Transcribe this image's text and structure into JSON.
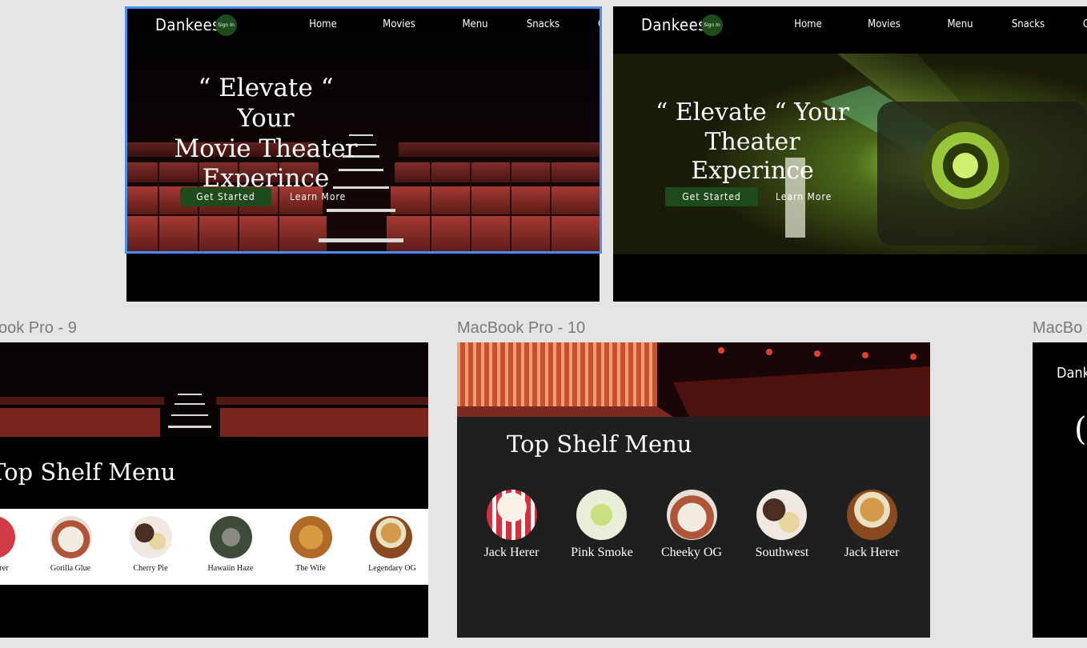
{
  "frames": {
    "f9_label": "ook Pro - 9",
    "f10_label": "MacBook Pro - 10",
    "f11_label": "MacBo"
  },
  "nav": {
    "brand": "Dankees",
    "signin": "Sign In",
    "links": [
      "Home",
      "Movies",
      "Menu",
      "Snacks",
      "Order"
    ]
  },
  "hero1": {
    "line1": "“ Elevate “ Your",
    "line2": "Movie Theater",
    "line3": "Experince",
    "primary": "Get Started",
    "secondary": "Learn More"
  },
  "hero2": {
    "line1": "“ Elevate “ Your",
    "line2": "Theater Experince",
    "primary": "Get Started",
    "secondary": "Learn More"
  },
  "menu9": {
    "title": "Top Shelf Menu",
    "items": [
      "rer",
      "Gorilla Glue",
      "Cherry Pie",
      "Hawaiin Haze",
      "The Wife",
      "Legendary OG"
    ]
  },
  "menu10": {
    "title": "Top Shelf Menu",
    "items": [
      "Jack Herer",
      "Pink Smoke",
      "Cheeky OG",
      "Southwest",
      "Jack Herer"
    ]
  },
  "frame11": {
    "brand": "Dank",
    "glyph": "("
  },
  "colors": {
    "canvas": "#e5e5e5",
    "accent_green": "#1f4a1b",
    "seat_red": "#8a2a26",
    "selection_blue": "#4a8ff0",
    "menu_bg": "#1f1f1f"
  }
}
